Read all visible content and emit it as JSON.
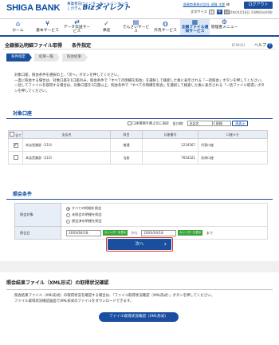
{
  "header": {
    "bank_name": "SHIGA BANK",
    "tagline_line1": "事業者向けインターネットバンキング",
    "tagline_brand_prefix": "しがぎん",
    "tagline_brand": "Bizダイレクト",
    "user_name": "滋賀商事株式会社 滋賀 太郎",
    "user_suffix": "様",
    "char_size_label": "文字サイズ",
    "char_sizes": [
      "小",
      "中",
      "大"
    ],
    "logout": "ログアウト",
    "clock": "20XX年04月18日 10時00分00秒"
  },
  "nav": [
    {
      "label": "ホーム",
      "icon": "home-icon",
      "glyph": "⌂"
    },
    {
      "label": "基本サービス",
      "icon": "yen-icon",
      "glyph": "¥"
    },
    {
      "label": "データ伝送サービス",
      "icon": "transfer-icon",
      "glyph": "⇄"
    },
    {
      "label": "承認",
      "icon": "approve-icon",
      "glyph": "✓"
    },
    {
      "label": "でんさいサービス",
      "icon": "document-icon",
      "glyph": "▤"
    },
    {
      "label": "外為サービス",
      "icon": "globe-icon",
      "glyph": "◍"
    },
    {
      "label": "全銀ファイル通知サービス",
      "icon": "file-icon",
      "glyph": "▦"
    },
    {
      "label": "管理者メニュー",
      "icon": "admin-icon",
      "glyph": "⚙"
    }
  ],
  "page": {
    "title": "全銀振込明細ファイル取得　　条件指定",
    "code": "BFMI001",
    "help": "ヘルプ"
  },
  "steps": [
    "条件指定",
    "結果一覧",
    "照会結果"
  ],
  "instructions": [
    "対象口座、照会条件を選択の上、「次へ」ボタンを押してください。",
    "一度に照会する場合は、対象口座を1口座のみ、照会条件で「すべての明細を照会」を選択して検索した後に表示される「一括照会」ボタンを押してください。",
    "一括してファイルを取得する場合は、対象口座を1口座以上、照会条件で「すべての明細を照会」を選択して検索した後に表示される「一括ファイル取得」ボタンを押してください。"
  ],
  "accounts": {
    "section_title": "対象口座",
    "ctrl_checkbox_label": "口座情報を最上位に固定",
    "sort_label": "並び順：",
    "sort_value": "支店名",
    "sort_order": "昇順",
    "redisplay": "再表示",
    "headers": [
      "全て",
      "支店名",
      "科目",
      "口座番号",
      "口座メモ"
    ],
    "rows": [
      {
        "checked": "✔",
        "branch": "本店営業部（110）",
        "subject": "普通",
        "number": "1234567",
        "memo": "代表口座"
      },
      {
        "checked": "",
        "branch": "本店営業部（110）",
        "subject": "当座",
        "number": "7654321",
        "memo": "決済口座"
      }
    ]
  },
  "conditions": {
    "section_title": "照会条件",
    "target_label": "照会対象",
    "options": [
      "すべての明細を照会",
      "未照会の明細を照会",
      "照会済の明細を照会"
    ],
    "date_label": "照会日",
    "date_from": "20XX/04/18",
    "date_to": "20XX/04/18",
    "calendar": "カレンダーを表示",
    "from_sep": "から",
    "to_sep": "まで"
  },
  "next_button": "次へ",
  "sub": {
    "title": "照会結果ファイル（XML形式）の取得状況確認",
    "text1": "照会結果ファイル（XML形式）の取得状況を確認する場合は、「ファイル取得状況確認（XML形式）」ボタンを押してください。",
    "text2": "ファイル取得状況確認画面でXML形式のファイルをダウンロードできます。",
    "button": "ファイル取得状況確認（XML形式）"
  }
}
